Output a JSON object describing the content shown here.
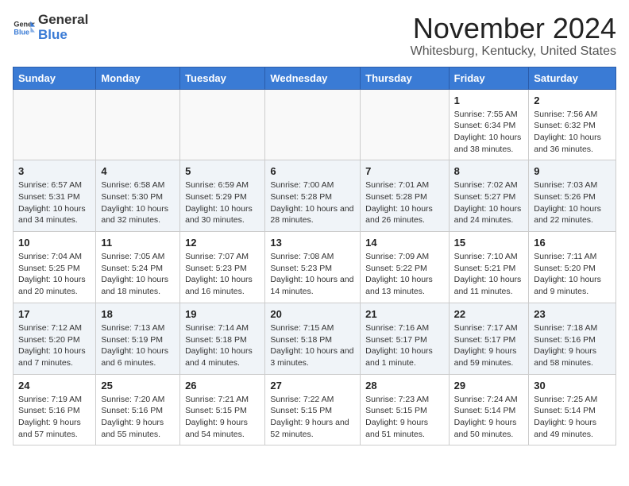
{
  "logo": {
    "general": "General",
    "blue": "Blue"
  },
  "title": "November 2024",
  "location": "Whitesburg, Kentucky, United States",
  "weekdays": [
    "Sunday",
    "Monday",
    "Tuesday",
    "Wednesday",
    "Thursday",
    "Friday",
    "Saturday"
  ],
  "weeks": [
    [
      {
        "day": "",
        "info": ""
      },
      {
        "day": "",
        "info": ""
      },
      {
        "day": "",
        "info": ""
      },
      {
        "day": "",
        "info": ""
      },
      {
        "day": "",
        "info": ""
      },
      {
        "day": "1",
        "info": "Sunrise: 7:55 AM\nSunset: 6:34 PM\nDaylight: 10 hours and 38 minutes."
      },
      {
        "day": "2",
        "info": "Sunrise: 7:56 AM\nSunset: 6:32 PM\nDaylight: 10 hours and 36 minutes."
      }
    ],
    [
      {
        "day": "3",
        "info": "Sunrise: 6:57 AM\nSunset: 5:31 PM\nDaylight: 10 hours and 34 minutes."
      },
      {
        "day": "4",
        "info": "Sunrise: 6:58 AM\nSunset: 5:30 PM\nDaylight: 10 hours and 32 minutes."
      },
      {
        "day": "5",
        "info": "Sunrise: 6:59 AM\nSunset: 5:29 PM\nDaylight: 10 hours and 30 minutes."
      },
      {
        "day": "6",
        "info": "Sunrise: 7:00 AM\nSunset: 5:28 PM\nDaylight: 10 hours and 28 minutes."
      },
      {
        "day": "7",
        "info": "Sunrise: 7:01 AM\nSunset: 5:28 PM\nDaylight: 10 hours and 26 minutes."
      },
      {
        "day": "8",
        "info": "Sunrise: 7:02 AM\nSunset: 5:27 PM\nDaylight: 10 hours and 24 minutes."
      },
      {
        "day": "9",
        "info": "Sunrise: 7:03 AM\nSunset: 5:26 PM\nDaylight: 10 hours and 22 minutes."
      }
    ],
    [
      {
        "day": "10",
        "info": "Sunrise: 7:04 AM\nSunset: 5:25 PM\nDaylight: 10 hours and 20 minutes."
      },
      {
        "day": "11",
        "info": "Sunrise: 7:05 AM\nSunset: 5:24 PM\nDaylight: 10 hours and 18 minutes."
      },
      {
        "day": "12",
        "info": "Sunrise: 7:07 AM\nSunset: 5:23 PM\nDaylight: 10 hours and 16 minutes."
      },
      {
        "day": "13",
        "info": "Sunrise: 7:08 AM\nSunset: 5:23 PM\nDaylight: 10 hours and 14 minutes."
      },
      {
        "day": "14",
        "info": "Sunrise: 7:09 AM\nSunset: 5:22 PM\nDaylight: 10 hours and 13 minutes."
      },
      {
        "day": "15",
        "info": "Sunrise: 7:10 AM\nSunset: 5:21 PM\nDaylight: 10 hours and 11 minutes."
      },
      {
        "day": "16",
        "info": "Sunrise: 7:11 AM\nSunset: 5:20 PM\nDaylight: 10 hours and 9 minutes."
      }
    ],
    [
      {
        "day": "17",
        "info": "Sunrise: 7:12 AM\nSunset: 5:20 PM\nDaylight: 10 hours and 7 minutes."
      },
      {
        "day": "18",
        "info": "Sunrise: 7:13 AM\nSunset: 5:19 PM\nDaylight: 10 hours and 6 minutes."
      },
      {
        "day": "19",
        "info": "Sunrise: 7:14 AM\nSunset: 5:18 PM\nDaylight: 10 hours and 4 minutes."
      },
      {
        "day": "20",
        "info": "Sunrise: 7:15 AM\nSunset: 5:18 PM\nDaylight: 10 hours and 3 minutes."
      },
      {
        "day": "21",
        "info": "Sunrise: 7:16 AM\nSunset: 5:17 PM\nDaylight: 10 hours and 1 minute."
      },
      {
        "day": "22",
        "info": "Sunrise: 7:17 AM\nSunset: 5:17 PM\nDaylight: 9 hours and 59 minutes."
      },
      {
        "day": "23",
        "info": "Sunrise: 7:18 AM\nSunset: 5:16 PM\nDaylight: 9 hours and 58 minutes."
      }
    ],
    [
      {
        "day": "24",
        "info": "Sunrise: 7:19 AM\nSunset: 5:16 PM\nDaylight: 9 hours and 57 minutes."
      },
      {
        "day": "25",
        "info": "Sunrise: 7:20 AM\nSunset: 5:16 PM\nDaylight: 9 hours and 55 minutes."
      },
      {
        "day": "26",
        "info": "Sunrise: 7:21 AM\nSunset: 5:15 PM\nDaylight: 9 hours and 54 minutes."
      },
      {
        "day": "27",
        "info": "Sunrise: 7:22 AM\nSunset: 5:15 PM\nDaylight: 9 hours and 52 minutes."
      },
      {
        "day": "28",
        "info": "Sunrise: 7:23 AM\nSunset: 5:15 PM\nDaylight: 9 hours and 51 minutes."
      },
      {
        "day": "29",
        "info": "Sunrise: 7:24 AM\nSunset: 5:14 PM\nDaylight: 9 hours and 50 minutes."
      },
      {
        "day": "30",
        "info": "Sunrise: 7:25 AM\nSunset: 5:14 PM\nDaylight: 9 hours and 49 minutes."
      }
    ]
  ]
}
